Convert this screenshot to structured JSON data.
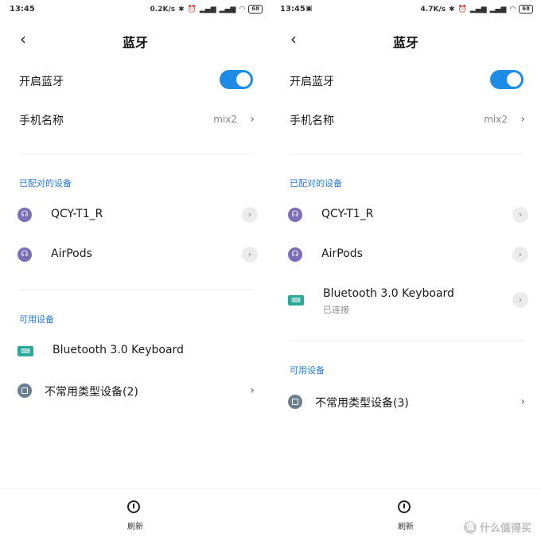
{
  "screens": [
    {
      "status": {
        "time": "13:45",
        "extra": "",
        "netspeed": "0.2K/s",
        "battery": "68"
      },
      "title": "蓝牙",
      "bluetooth_toggle_label": "开启蓝牙",
      "phone_name_label": "手机名称",
      "phone_name_value": "mix2",
      "paired_section": "已配对的设备",
      "paired": [
        {
          "name": "QCY-T1_R",
          "icon": "headset-icon"
        },
        {
          "name": "AirPods",
          "icon": "headset-icon"
        }
      ],
      "available_section": "可用设备",
      "available": [
        {
          "name": "Bluetooth 3.0 Keyboard",
          "icon": "keyboard-icon"
        },
        {
          "name": "不常用类型设备(2)",
          "icon": "device-icon"
        }
      ],
      "refresh_label": "刷新"
    },
    {
      "status": {
        "time": "13:45",
        "extra": "▣",
        "netspeed": "4.7K/s",
        "battery": "68"
      },
      "title": "蓝牙",
      "bluetooth_toggle_label": "开启蓝牙",
      "phone_name_label": "手机名称",
      "phone_name_value": "mix2",
      "paired_section": "已配对的设备",
      "paired": [
        {
          "name": "QCY-T1_R",
          "icon": "headset-icon"
        },
        {
          "name": "AirPods",
          "icon": "headset-icon"
        },
        {
          "name": "Bluetooth 3.0 Keyboard",
          "sub": "已连接",
          "icon": "keyboard-icon"
        }
      ],
      "available_section": "可用设备",
      "available": [
        {
          "name": "不常用类型设备(3)",
          "icon": "device-icon"
        }
      ],
      "refresh_label": "刷新"
    }
  ],
  "watermark": "什么值得买",
  "colors": {
    "accent": "#1e8ce6",
    "section": "#2d7bd6",
    "headset": "#7d6fb7",
    "keyboard": "#2aa89a",
    "device": "#6b7f91"
  }
}
